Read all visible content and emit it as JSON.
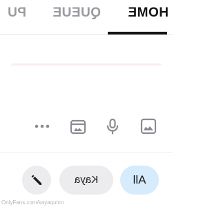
{
  "tabs": {
    "home": "HOME",
    "queue": "QUEUE",
    "third": "PU"
  },
  "toolbar": {
    "icons": [
      "image-icon",
      "mic-icon",
      "gallery-icon",
      "more-icon"
    ]
  },
  "filters": {
    "all_label": "All",
    "kaya_label": "Kaya",
    "edit_icon": "pencil-icon"
  },
  "watermark": "OnlyFans.com/kayaquinn",
  "colors": {
    "active_tab": "#141414",
    "inactive_tab": "#9a9aa0",
    "chip_selected": "#d6ebfc",
    "chip_default": "#ececee",
    "icon": "#8a8a94"
  }
}
